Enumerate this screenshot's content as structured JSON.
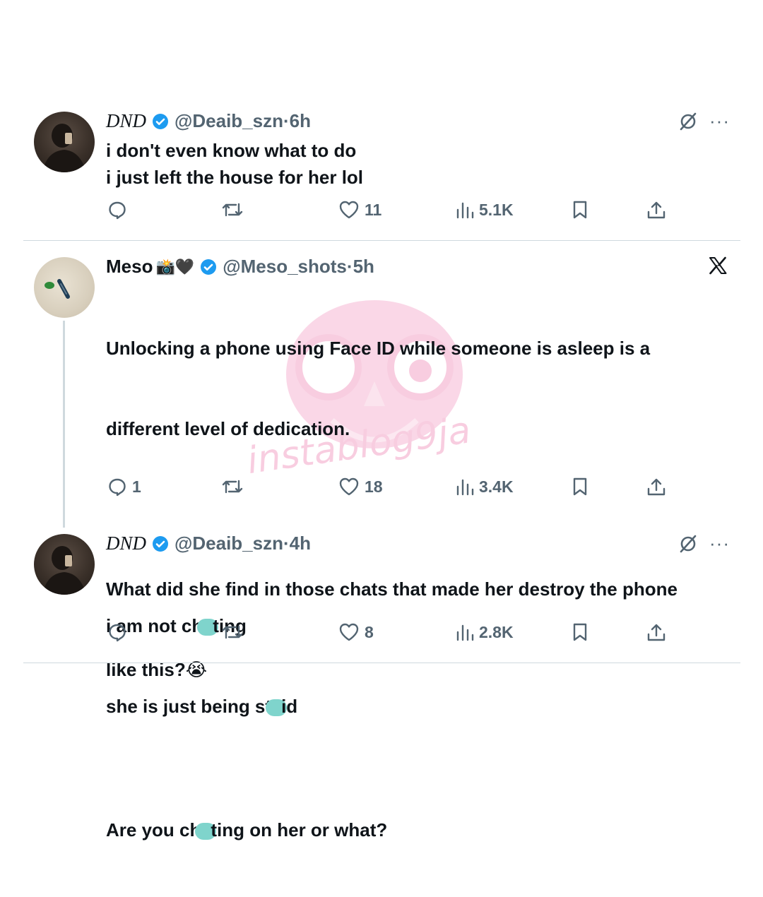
{
  "tweets": [
    {
      "name": "DND",
      "handle": "@Deaib_szn",
      "time": "6h",
      "lines": [
        "i don't even know what to do",
        "i just left the house for her lol"
      ],
      "replies": "",
      "likes": "11",
      "views": "5.1K"
    },
    {
      "name": "Meso",
      "emojis": "📸🖤",
      "handle": "@Meso_shots",
      "time": "5h",
      "lines": [
        "Unlocking a phone using Face ID while someone is asleep is a",
        "different level of dedication.",
        "",
        "What did she find in those chats that made her destroy the phone",
        "like this?😭",
        "",
        "Are you ch[?]ting on her or what?"
      ],
      "replies": "1",
      "likes": "18",
      "views": "3.4K"
    },
    {
      "name": "DND",
      "handle": "@Deaib_szn",
      "time": "4h",
      "lines": [
        "i am not ch[?]ting",
        "she is just being st[?]id"
      ],
      "replies": "",
      "likes": "8",
      "views": "2.8K"
    }
  ],
  "watermark": "instablog9ja",
  "colors": {
    "verified": "#1d9bf0",
    "muted": "#536471",
    "divider": "#cfd9de",
    "watermark": "#f3a6c8",
    "censor": "#7fd4cc"
  },
  "icons": [
    "verified-badge-icon",
    "grok-icon",
    "more-icon",
    "x-logo-icon",
    "reply-icon",
    "retweet-icon",
    "like-icon",
    "views-icon",
    "bookmark-icon",
    "share-icon"
  ]
}
